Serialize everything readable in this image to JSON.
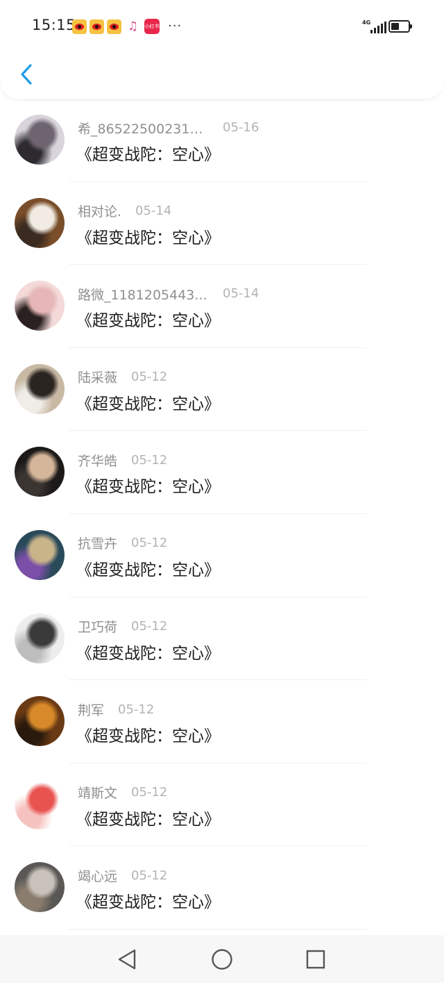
{
  "status_bar": {
    "time": "15:15",
    "network": "4G",
    "notification_icons": [
      "weibo-icon",
      "weibo-icon",
      "weibo-icon",
      "music-icon",
      "xiaohongshu-icon",
      "more-icon"
    ],
    "xhs_label": "小红书",
    "more": "···"
  },
  "header": {
    "back_icon": "chevron-left-icon",
    "accent": "#1e9be8"
  },
  "list": {
    "items": [
      {
        "name": "希_865225002319...",
        "date": "05-16",
        "title": "《超变战陀：空心》",
        "avatar_colors": [
          "#d9d4dc",
          "#6e6470",
          "#2d2a30"
        ]
      },
      {
        "name": "相对论.",
        "date": "05-14",
        "title": "《超变战陀：空心》",
        "avatar_colors": [
          "#7a4e2a",
          "#f1ebe3",
          "#3a2a1f"
        ]
      },
      {
        "name": "路微_1181205443...",
        "date": "05-14",
        "title": "《超变战陀：空心》",
        "avatar_colors": [
          "#f3dad8",
          "#e7b6b6",
          "#2a2020"
        ]
      },
      {
        "name": "陆采薇",
        "date": "05-12",
        "title": "《超变战陀：空心》",
        "avatar_colors": [
          "#c8b9a4",
          "#2b2522",
          "#f0ede8"
        ]
      },
      {
        "name": "齐华皓",
        "date": "05-12",
        "title": "《超变战陀：空心》",
        "avatar_colors": [
          "#1c1a19",
          "#d6b69a",
          "#3b3532"
        ]
      },
      {
        "name": "抗雪卉",
        "date": "05-12",
        "title": "《超变战陀：空心》",
        "avatar_colors": [
          "#2a4a5a",
          "#c9b48a",
          "#7b4ea8"
        ]
      },
      {
        "name": "卫巧荷",
        "date": "05-12",
        "title": "《超变战陀：空心》",
        "avatar_colors": [
          "#ededed",
          "#3a3a3a",
          "#bdbdbd"
        ]
      },
      {
        "name": "荆军",
        "date": "05-12",
        "title": "《超变战陀：空心》",
        "avatar_colors": [
          "#6a3a14",
          "#d8892a",
          "#2a1a0e"
        ]
      },
      {
        "name": "靖斯文",
        "date": "05-12",
        "title": "《超变战陀：空心》",
        "avatar_colors": [
          "#ffffff",
          "#e8524f",
          "#f6c2c0"
        ]
      },
      {
        "name": "竭心远",
        "date": "05-12",
        "title": "《超变战陀：空心》",
        "avatar_colors": [
          "#5a5855",
          "#c8c2ba",
          "#8a7d6e"
        ]
      }
    ]
  },
  "navbar": {
    "icons": [
      "back-triangle-icon",
      "home-circle-icon",
      "recents-square-icon"
    ]
  }
}
